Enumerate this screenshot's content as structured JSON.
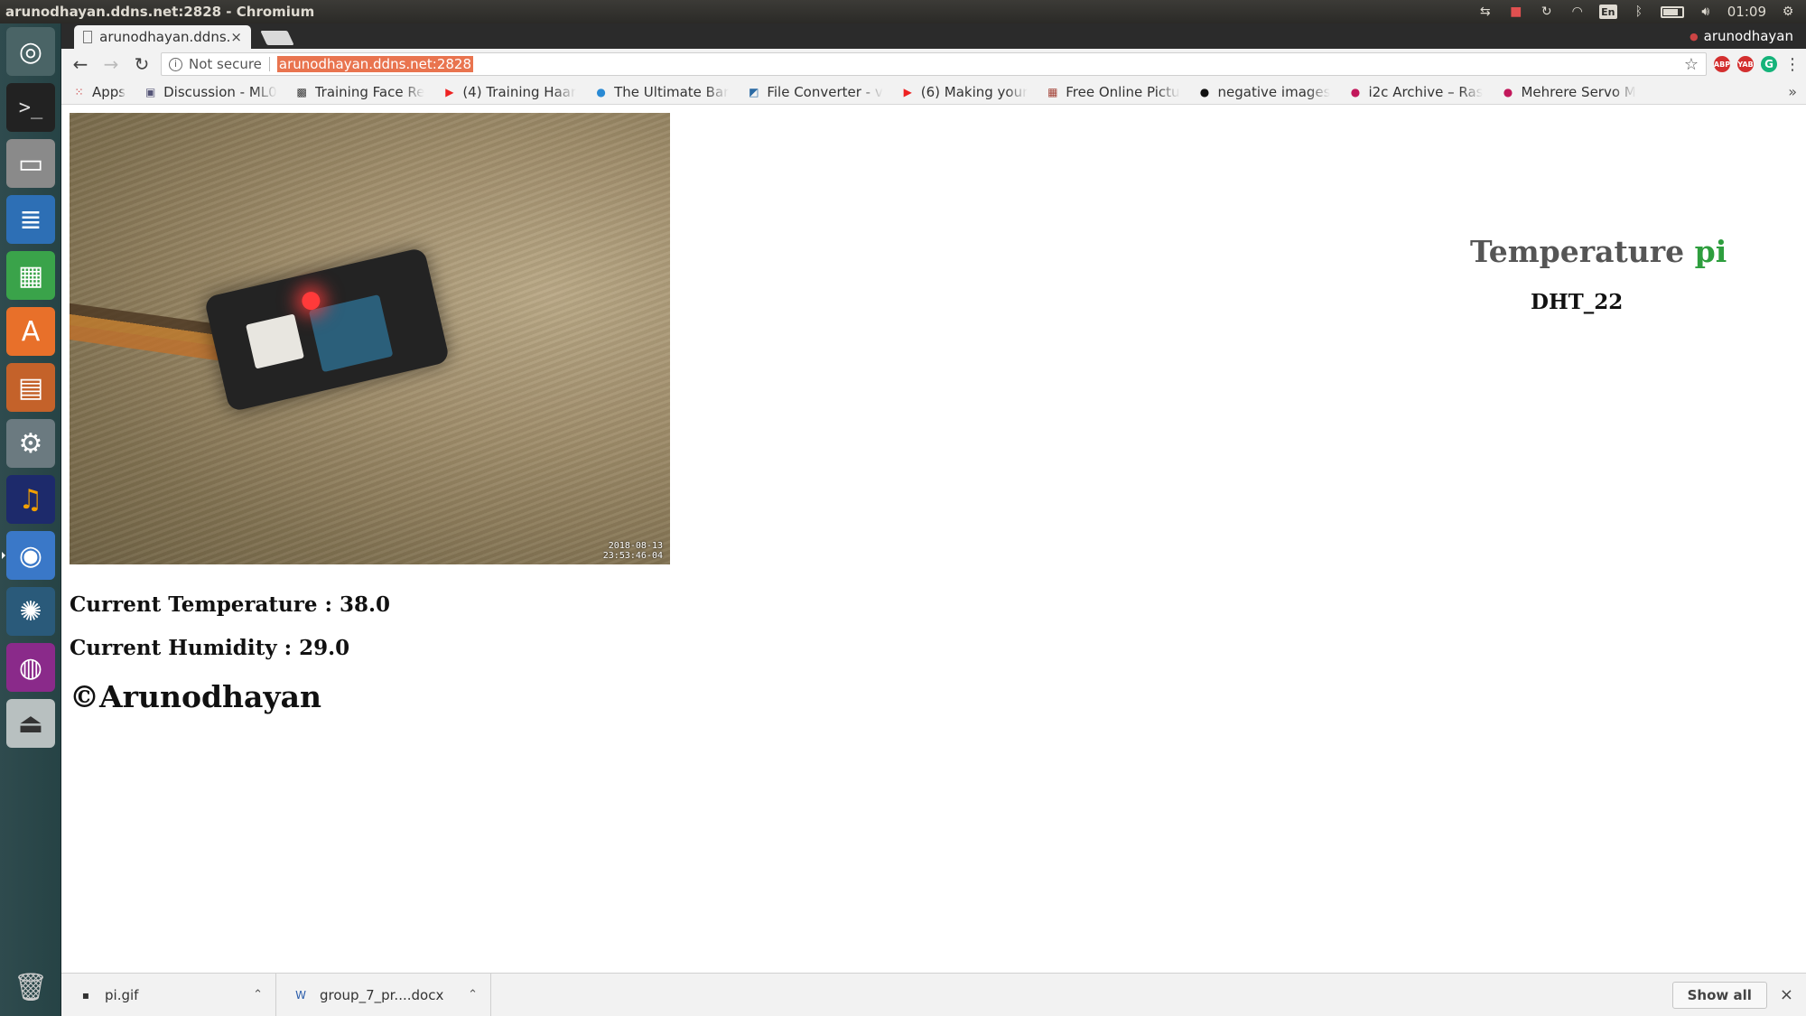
{
  "window": {
    "title": "arunodhayan.ddns.net:2828 - Chromium",
    "tray": {
      "lang": "En",
      "time": "01:09",
      "user": "arunodhayan"
    }
  },
  "browser": {
    "tab": {
      "title": "arunodhayan.ddns."
    },
    "omnibox": {
      "security": "Not secure",
      "url": "arunodhayan.ddns.net:2828"
    },
    "extensions": [
      "ABP",
      "YAB",
      "G"
    ],
    "bookmarks": [
      {
        "label": "Apps",
        "icon": "apps-grid-icon"
      },
      {
        "label": "Discussion - ML0",
        "icon": "discussion-icon"
      },
      {
        "label": "Training Face Re",
        "icon": "face-icon"
      },
      {
        "label": "(4) Training Haar",
        "icon": "youtube-icon"
      },
      {
        "label": "The Ultimate Bar",
        "icon": "pyimage-icon"
      },
      {
        "label": "File Converter - v",
        "icon": "converter-icon"
      },
      {
        "label": "(6) Making your",
        "icon": "youtube-icon"
      },
      {
        "label": "Free Online Pictu",
        "icon": "picture-icon"
      },
      {
        "label": "negative images",
        "icon": "github-icon"
      },
      {
        "label": "i2c Archive – Ras",
        "icon": "raspberry-icon"
      },
      {
        "label": "Mehrere Servo M",
        "icon": "raspberry-icon"
      }
    ]
  },
  "page": {
    "camera_stamp": [
      "2018-08-13",
      "23:53:46-04"
    ],
    "brand": {
      "title_main": "Temperature",
      "title_accent": "pi"
    },
    "sensor_model": "DHT_22",
    "temperature": "Current Temperature : 38.0",
    "humidity": "Current Humidity : 29.0",
    "copyright": "©Arunodhayan"
  },
  "downloads": {
    "items": [
      {
        "name": "pi.gif",
        "icon": "gif-file-icon"
      },
      {
        "name": "group_7_pr....docx",
        "icon": "word-doc-icon"
      }
    ],
    "show_all": "Show all"
  },
  "colors": {
    "accent_green": "#2e9e3e",
    "url_highlight": "#e9744f"
  }
}
